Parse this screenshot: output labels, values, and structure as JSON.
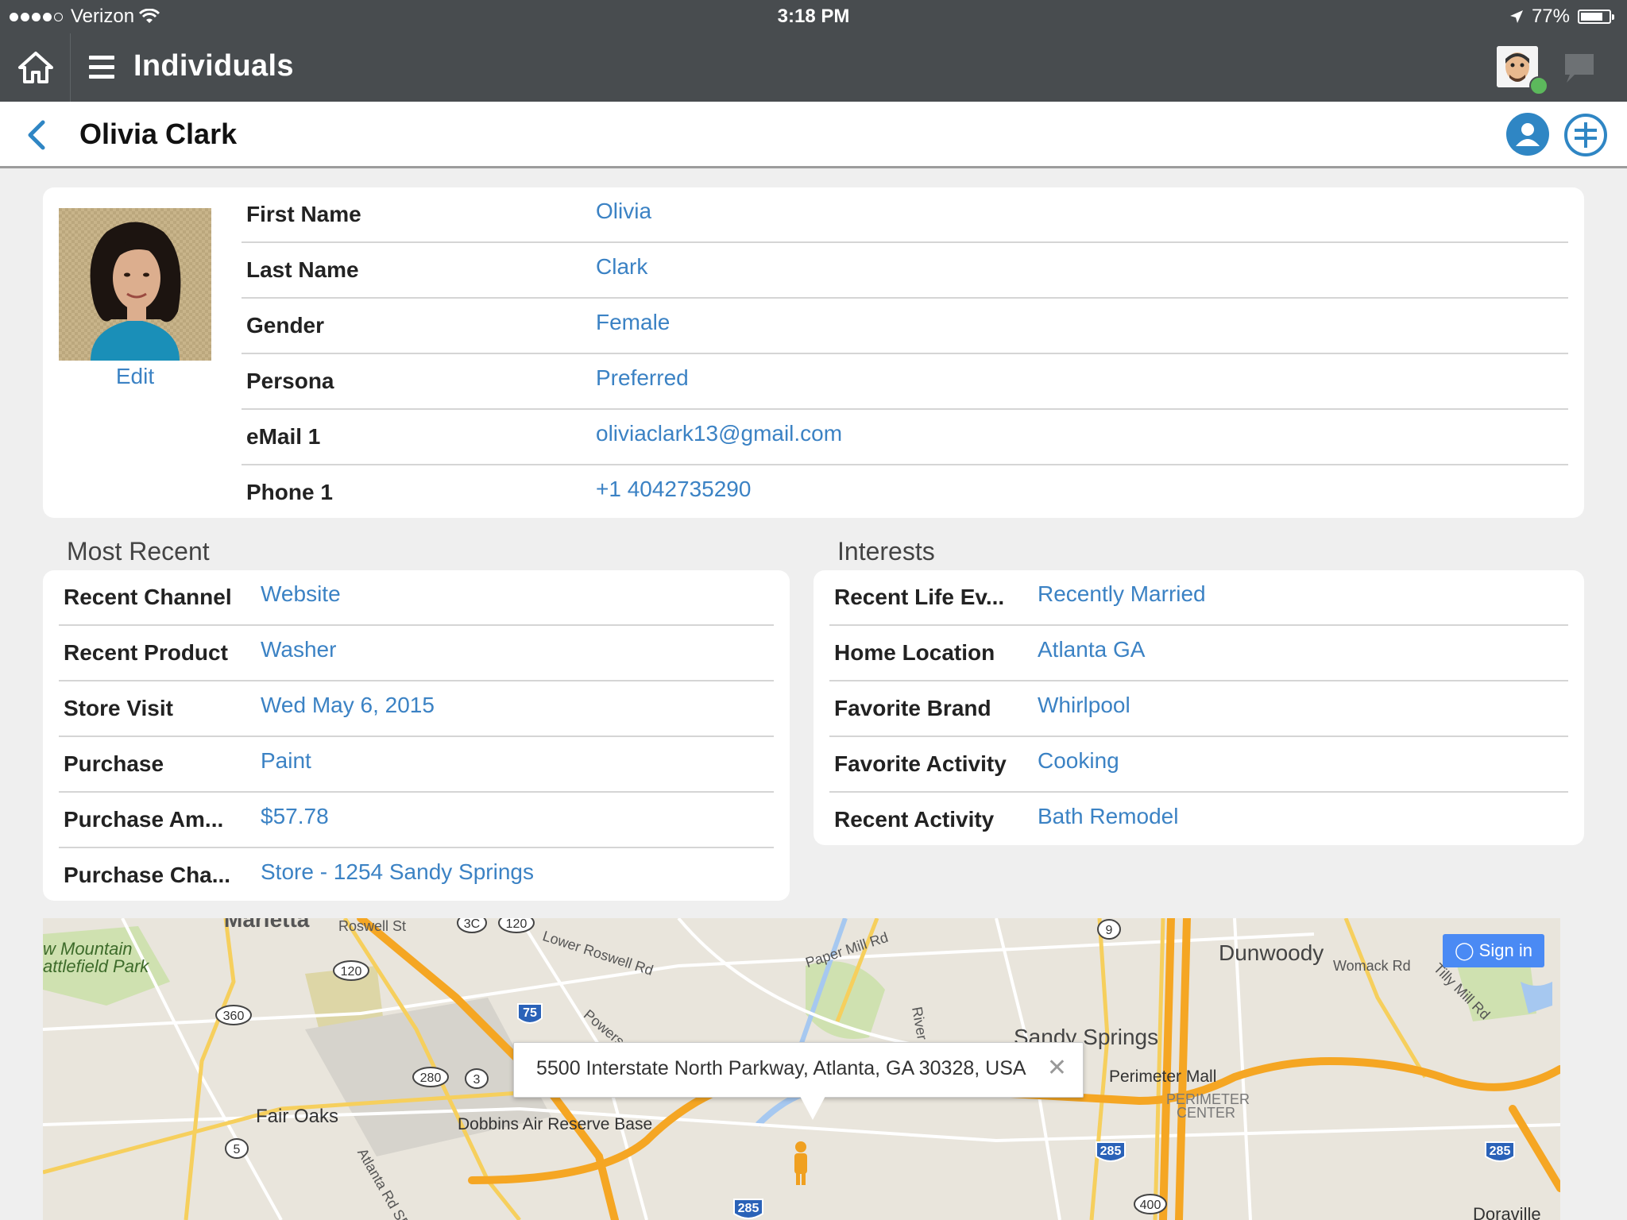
{
  "status_bar": {
    "carrier": "Verizon",
    "time": "3:18 PM",
    "battery": "77%"
  },
  "app_bar": {
    "title": "Individuals",
    "icons": [
      "home-icon",
      "menu-icon",
      "user-avatar",
      "chat-icon"
    ]
  },
  "sub_header": {
    "title": "Olivia Clark",
    "icons": [
      "back-icon",
      "profile-icon",
      "add-icon"
    ]
  },
  "profile": {
    "edit_label": "Edit",
    "fields": [
      {
        "label": "First Name",
        "value": "Olivia"
      },
      {
        "label": "Last Name",
        "value": "Clark"
      },
      {
        "label": "Gender",
        "value": "Female"
      },
      {
        "label": "Persona",
        "value": "Preferred"
      },
      {
        "label": "eMail 1",
        "value": "oliviaclark13@gmail.com"
      },
      {
        "label": "Phone 1",
        "value": "+1 4042735290"
      }
    ]
  },
  "most_recent": {
    "title": "Most Recent",
    "fields": [
      {
        "label": "Recent Channel",
        "value": "Website"
      },
      {
        "label": "Recent Product",
        "value": "Washer"
      },
      {
        "label": "Store Visit",
        "value": "Wed May 6, 2015"
      },
      {
        "label": "Purchase",
        "value": "Paint"
      },
      {
        "label": "Purchase Am...",
        "value": "$57.78"
      },
      {
        "label": "Purchase Cha...",
        "value": "Store - 1254 Sandy Springs"
      }
    ]
  },
  "interests": {
    "title": "Interests",
    "fields": [
      {
        "label": "Recent Life Ev...",
        "value": "Recently Married"
      },
      {
        "label": "Home Location",
        "value": "Atlanta GA"
      },
      {
        "label": "Favorite Brand",
        "value": "Whirlpool"
      },
      {
        "label": "Favorite Activity",
        "value": "Cooking"
      },
      {
        "label": "Recent Activity",
        "value": "Bath Remodel"
      }
    ]
  },
  "map": {
    "sign_in": "Sign in",
    "popup_address": "5500 Interstate North Parkway, Atlanta, GA 30328, USA",
    "labels": {
      "marietta": "Marietta",
      "mountain": "w Mountain",
      "battlefield": "attlefield Park",
      "roswell_st": "Roswell St",
      "lower_roswell": "Lower Roswell Rd",
      "paper_mill": "Paper Mill Rd",
      "dunwoody": "Dunwoody",
      "womack": "Womack Rd",
      "tilly_mill": "Tilly Mill Rd",
      "sandy_springs": "Sandy Springs",
      "perimeter_mall": "Perimeter Mall",
      "perimeter_center": "PERIMETER CENTER",
      "fair_oaks": "Fair Oaks",
      "dobbins": "Dobbins Air Reserve Base",
      "powers": "Powers",
      "river": "River",
      "atlanta_rd": "Atlanta Rd SE",
      "doraville": "Doraville"
    },
    "shields": {
      "r120a": "120",
      "r120b": "120",
      "r3c": "3C",
      "r360": "360",
      "r280": "280",
      "r3": "3",
      "r5": "5",
      "r9": "9",
      "i75": "75",
      "i285a": "285",
      "i285b": "285",
      "i285c": "285",
      "r400": "400"
    },
    "colors": {
      "highway": "#f5a623",
      "water": "#a6c8f0",
      "park": "#c8dfa8"
    }
  }
}
